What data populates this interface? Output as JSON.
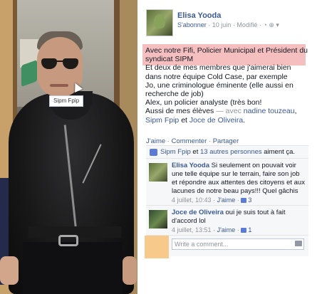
{
  "photo": {
    "tag_label": "Sipm Fpip"
  },
  "post": {
    "author": "Elisa Yooda",
    "subscribe": "S'abonner",
    "date": "10 juin",
    "modified": "Modifié",
    "body": {
      "line1": "Avec notre Fifi, Policier Municipal et Président du syndicat SIPM",
      "line2": "Et deux de mes membres que j'aimerai bien dans notre équipe Cold Case, par exemple",
      "line3": "Jo, une criminologue éminente (elle aussi en recherche de job)",
      "line4": "Alex, un policier analyste (très bon!",
      "line5_prefix": "Aussi de mes élèves",
      "line5_with": "— avec",
      "tag1": "nadine touzeau",
      "tag2": "Sipm Fpip",
      "conj": "et",
      "tag3": "Joce de Oliveira",
      "end": "."
    },
    "actions": {
      "like": "J'aime",
      "comment": "Commenter",
      "share": "Partager"
    },
    "likes": {
      "who": "Sipm Fpip",
      "and": "et",
      "others": "13 autres personnes",
      "suffix": "aiment ça."
    },
    "comments": [
      {
        "name": "Elisa Yooda",
        "text": "Si seulement on pouvait voir une telle équipe sur le terrain, faire son job et répondre aux attentes des citoyens et aux lacunes de notre beau pays!!! Quel gâchis",
        "time": "4 juillet, 10:43",
        "like": "J'aime",
        "count": "3"
      },
      {
        "name": "Joce de Oliveira",
        "text": "oui je suis tout à fait d'accord lol",
        "time": "4 juillet, 13:51",
        "like": "J'aime",
        "count": "1"
      }
    ],
    "write_placeholder": "Write a comment..."
  }
}
